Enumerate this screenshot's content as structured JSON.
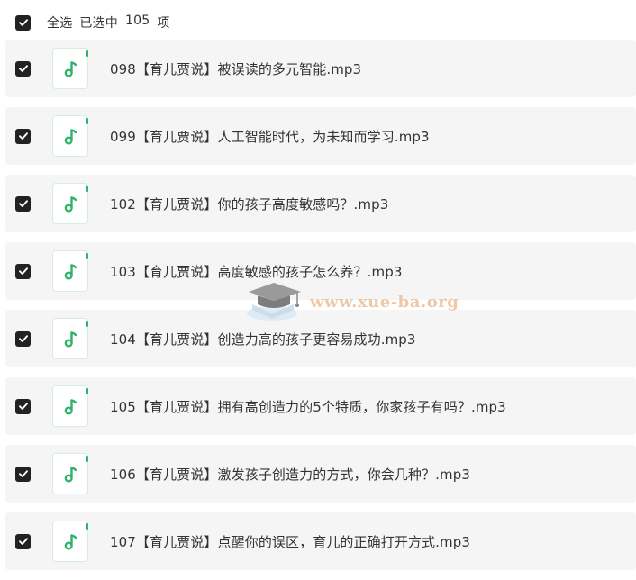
{
  "header": {
    "select_all_label": "全选",
    "selected_label": "已选中",
    "selected_count": "105",
    "unit_label": "项"
  },
  "files": [
    {
      "name": "098【育儿贾说】被误读的多元智能.mp3",
      "checked": true
    },
    {
      "name": "099【育儿贾说】人工智能时代，为未知而学习.mp3",
      "checked": true
    },
    {
      "name": "102【育儿贾说】你的孩子高度敏感吗？.mp3",
      "checked": true
    },
    {
      "name": "103【育儿贾说】高度敏感的孩子怎么养？.mp3",
      "checked": true
    },
    {
      "name": "104【育儿贾说】创造力高的孩子更容易成功.mp3",
      "checked": true
    },
    {
      "name": "105【育儿贾说】拥有高创造力的5个特质，你家孩子有吗？.mp3",
      "checked": true
    },
    {
      "name": "106【育儿贾说】激发孩子创造力的方式，你会几种？.mp3",
      "checked": true
    },
    {
      "name": "107【育儿贾说】点醒你的误区，育儿的正确打开方式.mp3",
      "checked": true
    }
  ],
  "icons": {
    "checkbox": "checkbox-checked-icon",
    "file": "audio-file-icon"
  },
  "colors": {
    "checkbox_fill": "#222222",
    "icon_accent": "#2fb26a",
    "row_background": "#f5f5f5",
    "watermark": "#e7b88a"
  },
  "watermark": {
    "text": "www.xue-ba.org"
  }
}
